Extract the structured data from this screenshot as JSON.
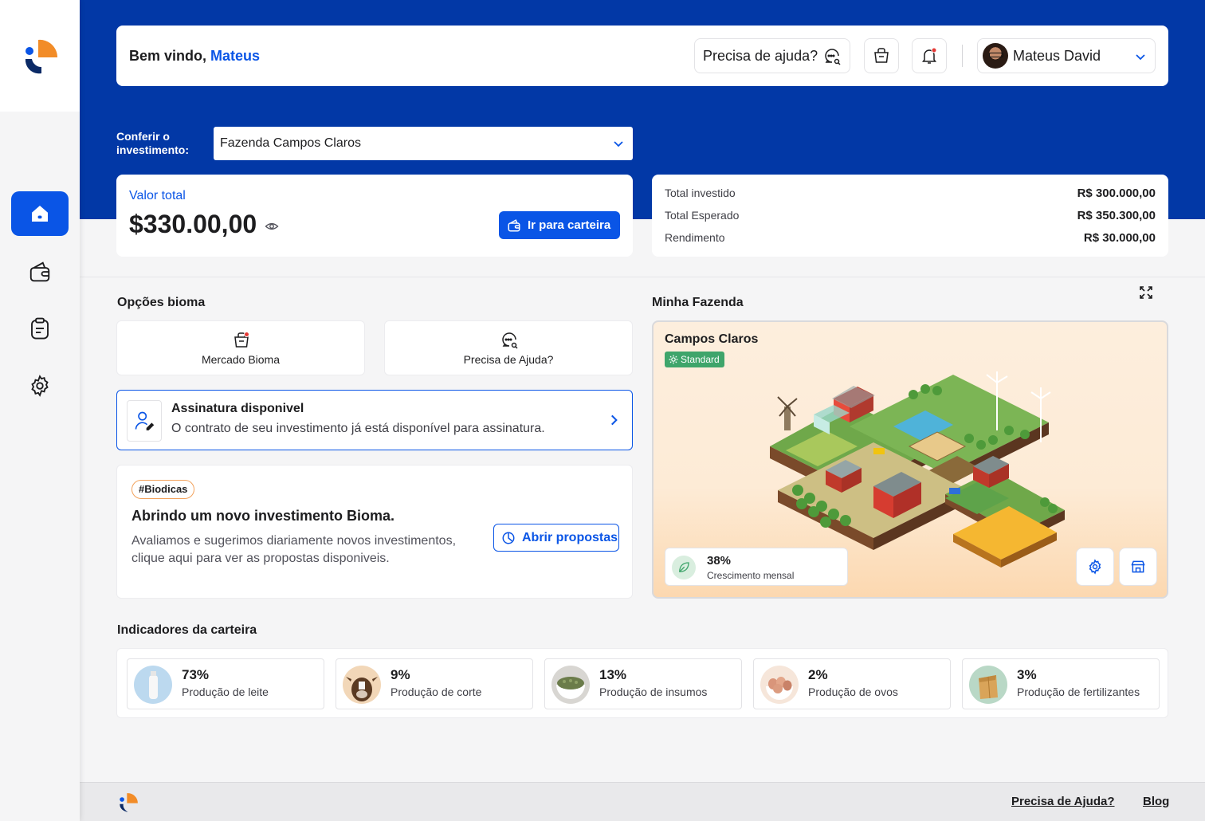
{
  "brand": {
    "orange": "#F28C28",
    "navy": "#0B2A66",
    "blue": "#0A55E6",
    "header_blue": "#0238A6"
  },
  "sidebar": {
    "items": [
      {
        "name": "home",
        "icon": "home-icon",
        "active": true
      },
      {
        "name": "wallet",
        "icon": "wallet-icon",
        "active": false
      },
      {
        "name": "contracts",
        "icon": "clipboard-icon",
        "active": false
      },
      {
        "name": "settings",
        "icon": "gear-icon",
        "active": false
      }
    ]
  },
  "header": {
    "welcome_prefix": "Bem vindo, ",
    "welcome_name": "Mateus",
    "help_label": "Precisa de ajuda?",
    "user_name": "Mateus David",
    "notification_dot_color": "#E53935"
  },
  "investment": {
    "label": "Conferir o investimento:",
    "selected": "Fazenda Campos Claros"
  },
  "valor": {
    "label": "Valor total",
    "amount": "$330.00,00",
    "wallet_button": "Ir para carteira"
  },
  "totals": [
    {
      "label": "Total investido",
      "value": "R$ 300.000,00"
    },
    {
      "label": "Total Esperado",
      "value": "R$ 350.300,00"
    },
    {
      "label": "Rendimento",
      "value": "R$ 30.000,00"
    }
  ],
  "options": {
    "title": "Opções bioma",
    "items": [
      {
        "label": "Mercado Bioma",
        "icon": "basket-icon"
      },
      {
        "label": "Precisa de Ajuda?",
        "icon": "chat-search-icon"
      }
    ]
  },
  "assinatura": {
    "title": "Assinatura disponivel",
    "subtitle": "O contrato de seu investimento já está disponível para assinatura."
  },
  "biodicas": {
    "tag": "#Biodicas",
    "title": "Abrindo um novo investimento Bioma.",
    "text": "Avaliamos e sugerimos diariamente novos investimentos, clique aqui para ver as propostas disponiveis.",
    "button": "Abrir propostas"
  },
  "farm": {
    "section_title": "Minha Fazenda",
    "name": "Campos Claros",
    "badge": "Standard",
    "growth_value": "38%",
    "growth_label": "Crescimento mensal"
  },
  "indicators": {
    "title": "Indicadores da carteira",
    "items": [
      {
        "pct": "73%",
        "label": "Produção de leite",
        "thumb": "milk"
      },
      {
        "pct": "9%",
        "label": "Produção de corte",
        "thumb": "cow"
      },
      {
        "pct": "13%",
        "label": "Produção de insumos",
        "thumb": "seeds"
      },
      {
        "pct": "2%",
        "label": "Produção de ovos",
        "thumb": "eggs"
      },
      {
        "pct": "3%",
        "label": "Produção de fertilizantes",
        "thumb": "fertilizer"
      }
    ]
  },
  "footer": {
    "help_link": "Precisa de Ajuda?",
    "blog_link": "Blog"
  }
}
